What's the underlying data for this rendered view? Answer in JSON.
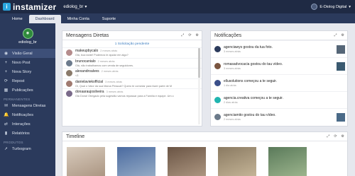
{
  "app": {
    "brand": "instamizer",
    "logo_glyph": "i",
    "account": "ediolog_br",
    "user_display": "E-Diolog Digital"
  },
  "tabs": [
    "Home",
    "Dashboard",
    "Minha Conta",
    "Suporte"
  ],
  "sidebar": {
    "profile_name": "ediolog_br",
    "items": [
      {
        "label": "Visão Geral",
        "icon": "eye-icon",
        "glyph": "◉"
      },
      {
        "label": "Novo Post",
        "icon": "plus-icon",
        "glyph": "+"
      },
      {
        "label": "Nova Story",
        "icon": "plus-icon",
        "glyph": "+"
      },
      {
        "label": "Repost",
        "icon": "repost-icon",
        "glyph": "⟳"
      },
      {
        "label": "Publicações",
        "icon": "grid-icon",
        "glyph": "▦"
      }
    ],
    "section_permanentes": "PERMANENTES",
    "items2": [
      {
        "label": "Mensagens Diretas",
        "icon": "message-icon",
        "glyph": "✉"
      },
      {
        "label": "Notificações",
        "icon": "bell-icon",
        "glyph": "🔔"
      },
      {
        "label": "Interações",
        "icon": "interaction-icon",
        "glyph": "⇄"
      },
      {
        "label": "Relatórios",
        "icon": "chart-icon",
        "glyph": "▮"
      }
    ],
    "section_produtos": "PRODUTOS",
    "items3": [
      {
        "label": "Turbogram",
        "icon": "rocket-icon",
        "glyph": "➚"
      }
    ]
  },
  "messages": {
    "title": "Mensagens Diretas",
    "pending": "1 Solicitação pendente",
    "items": [
      {
        "user": "makeupbycalo",
        "time": "2 meses atrás",
        "text": "Olá, boa tarde! Podemos te ajudar em algo?"
      },
      {
        "user": "brunocanialo",
        "time": "2 meses atrás",
        "text": "Olá, não trabalhamos com venda de seguidores."
      },
      {
        "user": "alexandroalves",
        "time": "2 meses atrás",
        "text": "<3"
      },
      {
        "user": "danielaviekofficial",
        "time": "3 meses atrás",
        "text": "Oi, Qual o Valor da sua Marca Pessoal? Quero te convidar para fazer parte de M"
      },
      {
        "user": "donaaraujosilveira",
        "time": "3 meses atrás",
        "text": "Olá Dona! Obrigado pela sugestão vamos repassar para a Família e equipe. Um o"
      }
    ]
  },
  "notifications": {
    "title": "Notificações",
    "items": [
      {
        "text": "agenciawys gostou da tua foto.",
        "time": "3 meses atrás",
        "color": "#2b3a5c",
        "thumb": "#556677"
      },
      {
        "text": "romasadvocacia gostou do tau vídeo.",
        "time": "3 meses atrás",
        "color": "#7a5540",
        "thumb": "#3a5a70"
      },
      {
        "text": "ellusolutions começou a te seguir.",
        "time": "1 dia atrás",
        "color": "#3a4f8a",
        "thumb": ""
      },
      {
        "text": "agencia.creativa começou a te seguir.",
        "time": "2 dias atrás",
        "color": "#20b5b0",
        "thumb": ""
      },
      {
        "text": "agenciamito gostou do tau vídeo.",
        "time": "2 meses atrás",
        "color": "#6b7a8a",
        "thumb": "#4a6a88"
      }
    ]
  },
  "timeline": {
    "title": "Timeline",
    "photos": [
      "#c8b8a8",
      "#7a8fb0",
      "#8a7060",
      "#9a8870",
      "#708a70",
      "#a09088"
    ]
  },
  "tools": {
    "expand": "⤢",
    "refresh": "⟳",
    "settings": "⚙"
  }
}
